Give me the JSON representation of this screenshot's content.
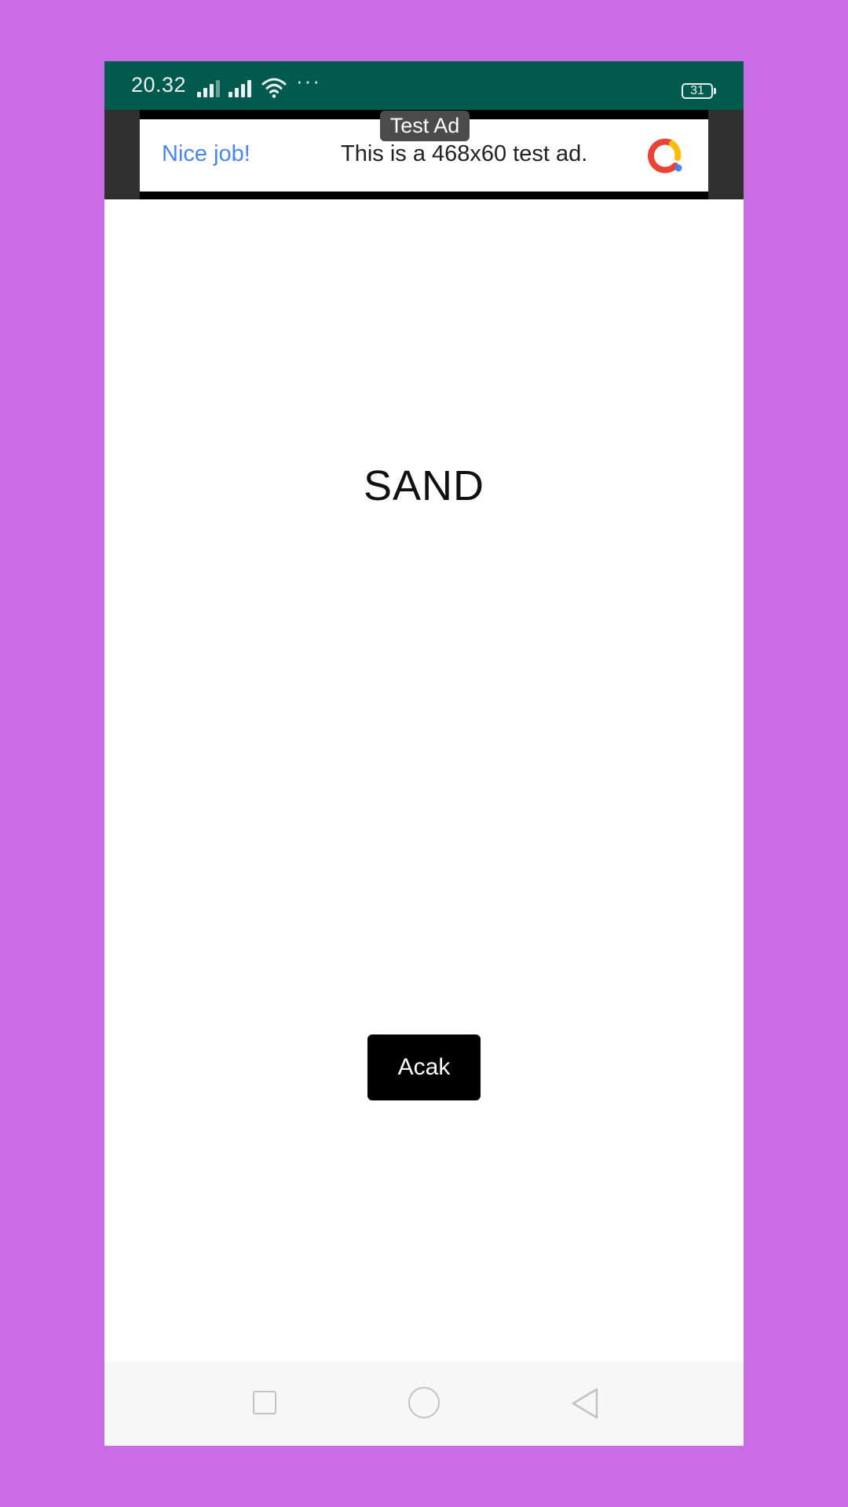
{
  "status_bar": {
    "time": "20.32",
    "battery_level": "31",
    "overflow_indicator": "···",
    "background_color": "#005a4d"
  },
  "ad_banner": {
    "badge": "Test Ad",
    "headline": "Nice job!",
    "body": "This is a 468x60 test ad.",
    "logo_icon": "google-ads-logo-icon",
    "headline_color": "#4a86e8"
  },
  "main": {
    "word": "SAND",
    "button_label": "Acak"
  },
  "nav_bar": {
    "recents_icon": "square-icon",
    "home_icon": "circle-icon",
    "back_icon": "triangle-back-icon"
  },
  "colors": {
    "page_background": "#c96ce6",
    "button_background": "#000000"
  }
}
